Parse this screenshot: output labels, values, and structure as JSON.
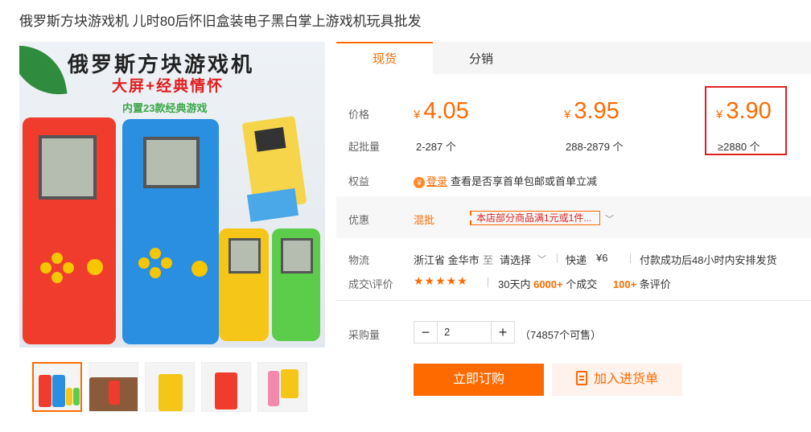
{
  "product": {
    "title": "俄罗斯方块游戏机 儿时80后怀旧盒装电子黑白掌上游戏机玩具批发"
  },
  "image": {
    "headline": "俄罗斯方块游戏机",
    "subline": "大屏+经典情怀",
    "note": "内置23款经典游戏",
    "thumbnail_count": 5
  },
  "tabs": [
    {
      "label": "现货",
      "active": true
    },
    {
      "label": "分销",
      "active": false
    }
  ],
  "pricing": {
    "price_label": "价格",
    "min_order_label": "起批量",
    "currency": "¥",
    "tiers": [
      {
        "price": "4.05",
        "quantity": "2-287 个"
      },
      {
        "price": "3.95",
        "quantity": "288-2879 个"
      },
      {
        "price": "3.90",
        "quantity": "≥2880 个",
        "highlighted": true
      }
    ]
  },
  "benefits": {
    "label": "权益",
    "link": "登录",
    "text": "查看是否享首单包邮或首单立减"
  },
  "promotion": {
    "label": "优惠",
    "type": "混批",
    "coupon": "本店部分商品满1元或1件..."
  },
  "logistics": {
    "label": "物流",
    "origin": "浙江省 金华市",
    "to": "至",
    "destination": "请选择",
    "express": "快递",
    "fee": "¥6",
    "dispatch": "付款成功后48小时内安排发货"
  },
  "sales": {
    "label": "成交\\评价",
    "stars": "★★★★★",
    "prefix": "30天内",
    "count": "6000+",
    "count_suffix": "个成交",
    "reviews": "100+",
    "reviews_suffix": "条评价"
  },
  "purchase": {
    "label": "采购量",
    "quantity": "2",
    "available": "（74857个可售）",
    "buy_label": "立即订购",
    "cart_label": "加入进货单"
  },
  "colors": {
    "accent": "#ff6a00",
    "highlight_border": "#e02020"
  }
}
